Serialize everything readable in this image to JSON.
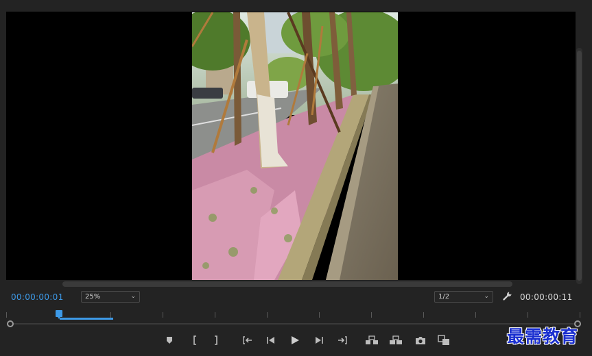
{
  "viewer": {
    "current_time": "00:00:00:01",
    "duration": "00:00:00:11",
    "zoom_level": "25%",
    "playback_resolution": "1/2"
  },
  "icons": {
    "zoom_chevron": "chevron-down-icon",
    "resolution_chevron": "chevron-down-icon",
    "settings": "wrench-icon"
  },
  "transport": {
    "buttons": [
      "add-marker",
      "mark-in",
      "mark-out",
      "go-to-in",
      "step-back",
      "play",
      "step-forward",
      "go-to-out",
      "lift",
      "extract",
      "export-frame",
      "compare-view"
    ]
  },
  "colors": {
    "accent": "#3d9ae8",
    "panel_bg": "#232323",
    "viewer_bg": "#000000",
    "watermark": "#1a2fd0"
  },
  "watermark": {
    "text": "最需教育"
  }
}
